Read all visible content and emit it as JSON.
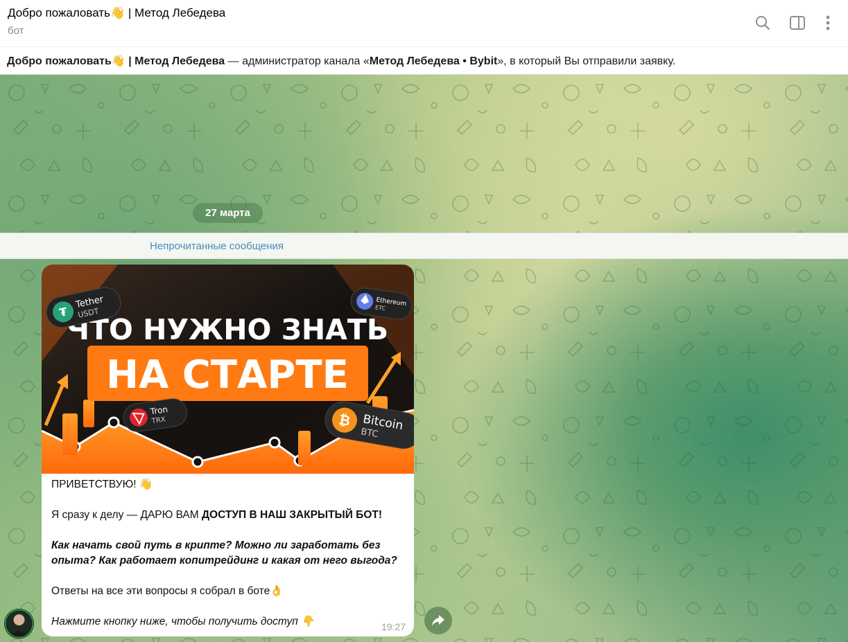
{
  "header": {
    "title": "Добро пожаловать👋 | Метод Лебедева",
    "subtitle": "бот",
    "icons": [
      "search-icon",
      "sidebar-toggle-icon",
      "more-vertical-icon"
    ]
  },
  "info_bar": {
    "bot_name": "Добро пожаловать👋 | Метод Лебедева",
    "middle": " — администратор канала «",
    "channel_name": "Метод Лебедева • Bybit",
    "end": "», в который Вы отправили заявку."
  },
  "chat": {
    "date_label": "27 марта",
    "unread_label": "Непрочитанные сообщения"
  },
  "message": {
    "banner": {
      "line1": "ЧТО НУЖНО ЗНАТЬ",
      "line2": "НА СТАРТЕ",
      "coins": [
        {
          "name": "Tether",
          "ticker": "USDT",
          "color": "#26a17b"
        },
        {
          "name": "Ethereum",
          "ticker": "ETC",
          "color": "#627eea"
        },
        {
          "name": "Tron",
          "ticker": "TRX",
          "color": "#e0242a"
        },
        {
          "name": "Bitcoin",
          "ticker": "BTC",
          "color": "#f7931a"
        }
      ],
      "accent": "#ff7a12"
    },
    "greeting": "ПРИВЕТСТВУЮ! 👋",
    "line2_plain": "Я сразу к делу — ДАРЮ ВАМ ",
    "line2_bold": "ДОСТУП В НАШ ЗАКРЫТЫЙ БОТ!",
    "questions": "Как начать свой путь в крипте? Можно ли заработать без опыта? Как работает копитрейдинг и какая от него выгода?",
    "answers": "Ответы на все эти вопросы я собрал в боте👌",
    "cta": "Нажмите кнопку ниже, чтобы получить доступ 👇",
    "time": "19:27"
  }
}
